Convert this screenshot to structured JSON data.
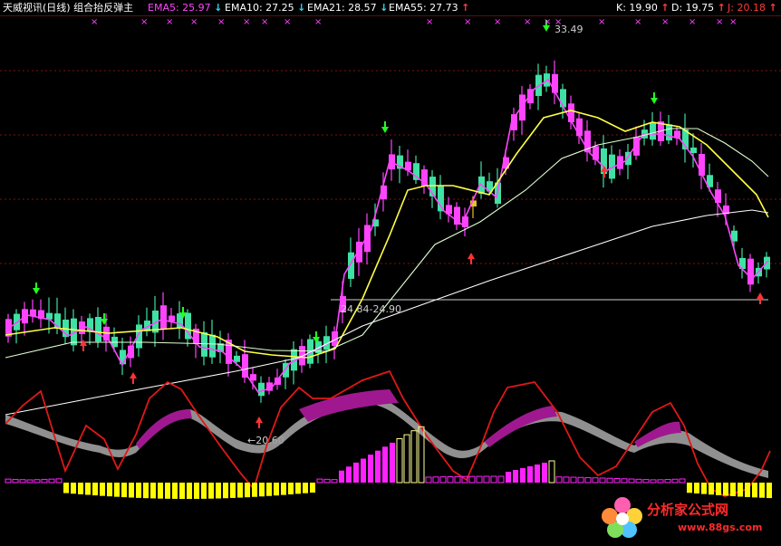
{
  "header": {
    "title": "天威视讯(日线) 组合抬反弹主",
    "ema5_label": "EMA5: 25.97",
    "ema10_label": "EMA10: 27.25",
    "ema21_label": "EMA21: 28.57",
    "ema55_label": "EMA55: 27.73",
    "k_label": "K: 19.90",
    "d_label": "D: 19.75",
    "j_label": "J: 20.18",
    "arrow_down": "↓",
    "arrow_up": "↑"
  },
  "annotations": {
    "high": "33.49",
    "range": "24.84-24.90",
    "low": "←20.60"
  },
  "watermark": {
    "site": "分析家公式网",
    "url": "www.88gs.com"
  },
  "colors": {
    "background": "#000000",
    "up_candle": "#ff44ff",
    "down_candle": "#3fe1a5",
    "signal_candle": "#e6c02a",
    "ema5": "#ff44ff",
    "ema10": "#ffff44",
    "ema21": "#e0ffd0",
    "ema55": "#ffffff",
    "kdj_red": "#e01818",
    "band_magenta": "#a01890",
    "band_gray": "#a0a0a0",
    "hist_magenta": "#ff22ff",
    "hist_yellow": "#ffff00"
  }
}
